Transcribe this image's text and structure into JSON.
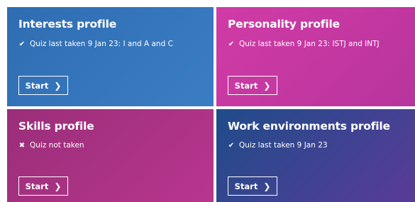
{
  "cards": [
    {
      "title": "Interests profile",
      "status_icon": "check-icon",
      "status_glyph": "✔",
      "status": "Quiz last taken 9 Jan 23: I and A and C",
      "button": "Start",
      "chevron": "❯",
      "colors": {
        "start": "#2f6db2",
        "end": "#3b7dc4"
      }
    },
    {
      "title": "Personality profile",
      "status_icon": "check-icon",
      "status_glyph": "✔",
      "status": "Quiz last taken 9 Jan 23: ISTJ and INTJ",
      "button": "Start",
      "chevron": "❯",
      "colors": {
        "start": "#d13ba6",
        "end": "#b8349d"
      }
    },
    {
      "title": "Skills profile",
      "status_icon": "cross-icon",
      "status_glyph": "✖",
      "status": "Quiz not taken",
      "button": "Start",
      "chevron": "❯",
      "colors": {
        "start": "#9a2e79",
        "end": "#b8368e"
      }
    },
    {
      "title": "Work environments profile",
      "status_icon": "check-icon",
      "status_glyph": "✔",
      "status": "Quiz last taken 9 Jan 23",
      "button": "Start",
      "chevron": "❯",
      "colors": {
        "start": "#1f4c8a",
        "end": "#5a3b97"
      }
    }
  ]
}
